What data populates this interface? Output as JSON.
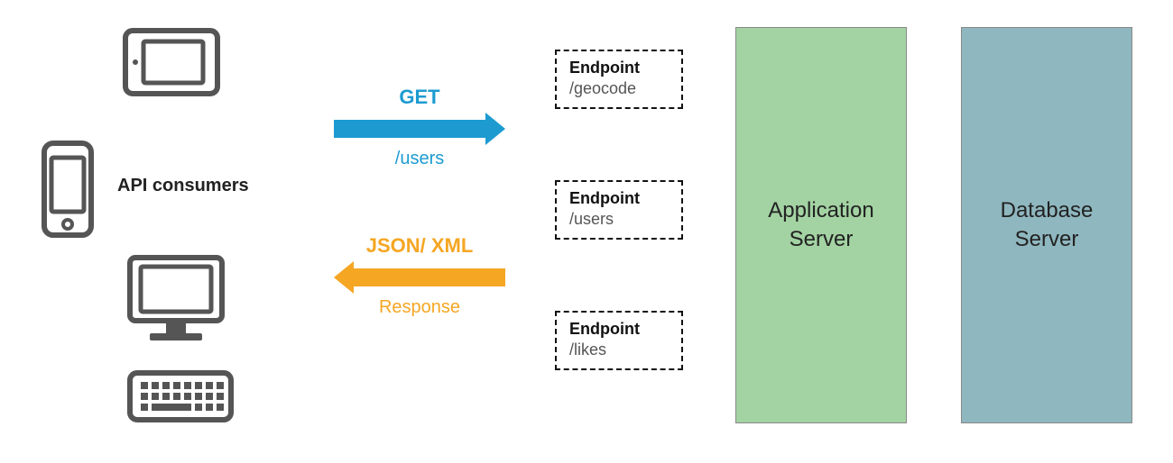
{
  "consumers": {
    "label": "API consumers",
    "icons": [
      "tablet",
      "phone",
      "desktop-keyboard"
    ]
  },
  "request": {
    "method": "GET",
    "path": "/users"
  },
  "response": {
    "format": "JSON/ XML",
    "label": "Response"
  },
  "endpoints": [
    {
      "title": "Endpoint",
      "path": "/geocode"
    },
    {
      "title": "Endpoint",
      "path": "/users"
    },
    {
      "title": "Endpoint",
      "path": "/likes"
    }
  ],
  "servers": {
    "application": "Application Server",
    "database": "Database Server"
  }
}
